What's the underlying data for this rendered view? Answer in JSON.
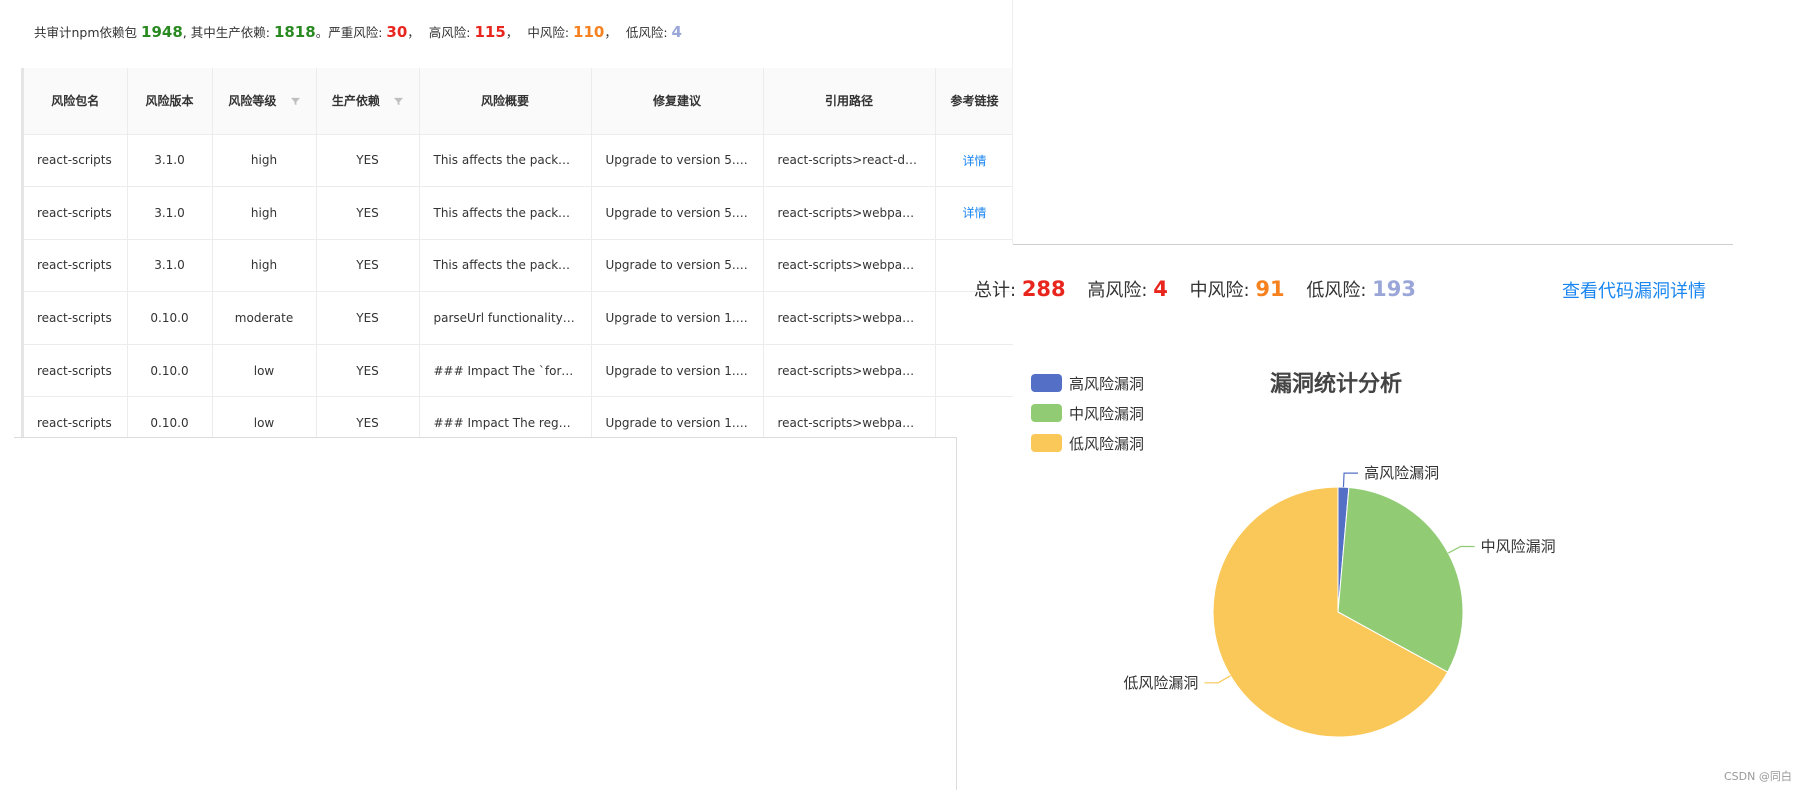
{
  "summary": {
    "prefix": "共审计npm依赖包",
    "total_pkgs": "1948",
    "prod_label": ", 其中生产依赖:",
    "prod_count": "1818",
    "severe_label": "。严重风险:",
    "severe_count": "30",
    "high_label": "高风险:",
    "high_count": "115",
    "mid_label": "中风险:",
    "mid_count": "110",
    "low_label": "低风险:",
    "low_count": "4",
    "sep": "，"
  },
  "colors": {
    "green": "#2a8a22",
    "red": "#e8261e",
    "orange": "#f5811f",
    "lavender": "#9aa6d8",
    "blue_link": "#1a86f0",
    "pie_high": "#5470c6",
    "pie_mid": "#91cc75",
    "pie_low": "#fac858"
  },
  "table": {
    "columns": [
      "风险包名",
      "风险版本",
      "风险等级",
      "生产依赖",
      "风险概要",
      "修复建议",
      "引用路径",
      "参考链接"
    ],
    "rows": [
      {
        "name": "react-scripts",
        "version": "3.1.0",
        "level": "high",
        "prod": "YES",
        "summary": "This affects the packag...",
        "fix": "Upgrade to version 5.1....",
        "path": "react-scripts>react-dev...",
        "link": "详情"
      },
      {
        "name": "react-scripts",
        "version": "3.1.0",
        "level": "high",
        "prod": "YES",
        "summary": "This affects the packag...",
        "fix": "Upgrade to version 5.1....",
        "path": "react-scripts>webpack...",
        "link": "详情"
      },
      {
        "name": "react-scripts",
        "version": "3.1.0",
        "level": "high",
        "prod": "YES",
        "summary": "This affects the packag...",
        "fix": "Upgrade to version 5.1....",
        "path": "react-scripts>webpack-...",
        "link": ""
      },
      {
        "name": "react-scripts",
        "version": "0.10.0",
        "level": "moderate",
        "prod": "YES",
        "summary": "parseUrl functionality in...",
        "fix": "Upgrade to version 1.0....",
        "path": "react-scripts>webpack-...",
        "link": ""
      },
      {
        "name": "react-scripts",
        "version": "0.10.0",
        "level": "low",
        "prod": "YES",
        "summary": "### Impact The `forge....",
        "fix": "Upgrade to version 1.0....",
        "path": "react-scripts>webpack-...",
        "link": ""
      },
      {
        "name": "react-scripts",
        "version": "0.10.0",
        "level": "low",
        "prod": "YES",
        "summary": "### Impact The regex u...",
        "fix": "Upgrade to version 1.0....",
        "path": "react-scripts>webpack-...",
        "link": ""
      }
    ]
  },
  "stats": {
    "total_label": "总计:",
    "total": "288",
    "high_label": "高风险:",
    "high": "4",
    "mid_label": "中风险:",
    "mid": "91",
    "low_label": "低风险:",
    "low": "193",
    "detail_link": "查看代码漏洞详情"
  },
  "chart_data": {
    "type": "pie",
    "title": "漏洞统计分析",
    "legend_position": "top-left",
    "categories": [
      "高风险漏洞",
      "中风险漏洞",
      "低风险漏洞"
    ],
    "values": [
      4,
      91,
      193
    ],
    "colors": [
      "#5470c6",
      "#91cc75",
      "#fac858"
    ]
  },
  "watermark": "CSDN @同白"
}
